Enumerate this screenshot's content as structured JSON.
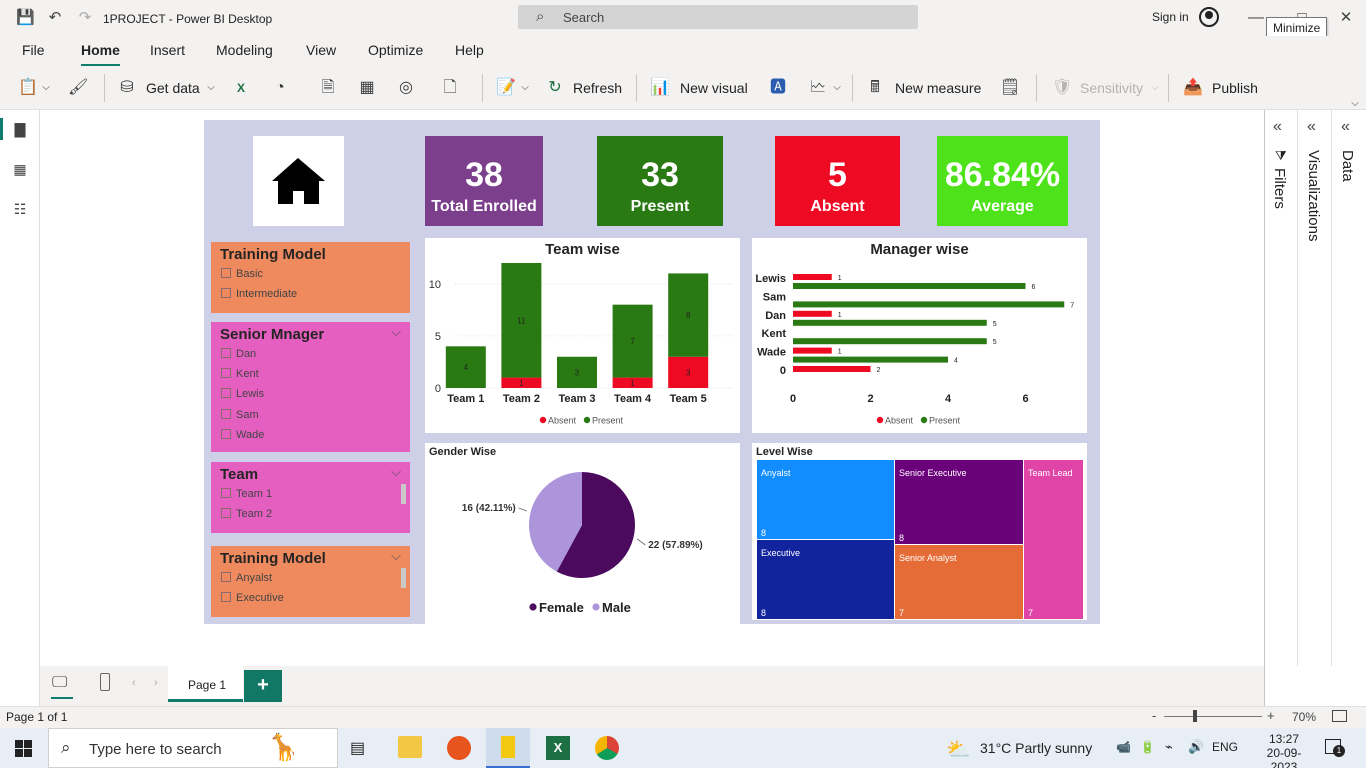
{
  "app": {
    "title": "1PROJECT - Power BI Desktop",
    "search_placeholder": "Search",
    "signin": "Sign in",
    "tooltip": "Minimize"
  },
  "menu": [
    "File",
    "Home",
    "Insert",
    "Modeling",
    "View",
    "Optimize",
    "Help"
  ],
  "ribbon": {
    "get_data": "Get data",
    "refresh": "Refresh",
    "new_visual": "New visual",
    "new_measure": "New measure",
    "sensitivity": "Sensitivity",
    "publish": "Publish"
  },
  "panes": {
    "filters": "Filters",
    "visualizations": "Visualizations",
    "data": "Data"
  },
  "kpis": [
    {
      "value": "38",
      "label": "Total Enrolled",
      "color": "#7b3f8c"
    },
    {
      "value": "33",
      "label": "Present",
      "color": "#2a7a14"
    },
    {
      "value": "5",
      "label": "Absent",
      "color": "#ee0a22"
    },
    {
      "value": "86.84%",
      "label": "Average",
      "color": "#4ee21a"
    }
  ],
  "slicers": [
    {
      "title": "Training Model",
      "options": [
        "Basic",
        "Intermediate"
      ],
      "color": "#ee8a5e",
      "has_chevron": false
    },
    {
      "title": "Senior Mnager",
      "options": [
        "Dan",
        "Kent",
        "Lewis",
        "Sam",
        "Wade"
      ],
      "color": "#e55fc1",
      "has_chevron": true
    },
    {
      "title": "Team",
      "options": [
        "Team 1",
        "Team 2"
      ],
      "color": "#e55fc1",
      "has_chevron": true
    },
    {
      "title": "Training Model",
      "options": [
        "Anyalst",
        "Executive"
      ],
      "color": "#ee8a5e",
      "has_chevron": true
    }
  ],
  "chart_data": [
    {
      "type": "bar",
      "title": "Team wise",
      "categories": [
        "Team 1",
        "Team 2",
        "Team 3",
        "Team 4",
        "Team 5"
      ],
      "series": [
        {
          "name": "Absent",
          "values": [
            0,
            1,
            0,
            1,
            3
          ],
          "color": "#ee0a22"
        },
        {
          "name": "Present",
          "values": [
            4,
            11,
            3,
            7,
            8
          ],
          "color": "#2a7a14"
        }
      ],
      "stacked": true,
      "y_ticks": [
        "0",
        "5",
        "10"
      ],
      "ylim": [
        0,
        12
      ],
      "legend": "bottom"
    },
    {
      "type": "bar",
      "orientation": "horizontal",
      "title": "Manager wise",
      "categories": [
        "Lewis",
        "Sam",
        "Dan",
        "Kent",
        "Wade",
        "0"
      ],
      "series": [
        {
          "name": "Absent",
          "values": [
            1,
            null,
            1,
            null,
            1,
            2
          ],
          "color": "#ee0a22"
        },
        {
          "name": "Present",
          "values": [
            6,
            7,
            5,
            5,
            4,
            null
          ],
          "color": "#2a7a14"
        }
      ],
      "x_ticks": [
        "0",
        "2",
        "4",
        "6"
      ],
      "xlim": [
        0,
        7.2
      ],
      "legend": "bottom"
    },
    {
      "type": "pie",
      "title": "Gender Wise",
      "slices": [
        {
          "name": "Female",
          "value": 22,
          "label": "22 (57.89%)",
          "color": "#4b0a5e"
        },
        {
          "name": "Male",
          "value": 16,
          "label": "16 (42.11%)",
          "color": "#ad95dc"
        }
      ],
      "legend": "bottom"
    },
    {
      "type": "treemap",
      "title": "Level Wise",
      "items": [
        {
          "name": "Anyalst",
          "value": "8",
          "color": "#118dff"
        },
        {
          "name": "Executive",
          "value": "8",
          "color": "#12239e"
        },
        {
          "name": "Senior Executive",
          "value": "8",
          "color": "#6b007b"
        },
        {
          "name": "Senior Analyst",
          "value": "7",
          "color": "#e66c37"
        },
        {
          "name": "Team Lead",
          "value": "7",
          "color": "#e044a7"
        }
      ]
    }
  ],
  "pages": {
    "tab": "Page 1",
    "status": "Page 1 of 1",
    "zoom": "70%"
  },
  "taskbar": {
    "search_placeholder": "Type here to search",
    "temp": "31°C",
    "weather": "Partly sunny",
    "lang": "ENG",
    "time": "13:27",
    "date": "20-09-2023",
    "notif_count": "1"
  }
}
